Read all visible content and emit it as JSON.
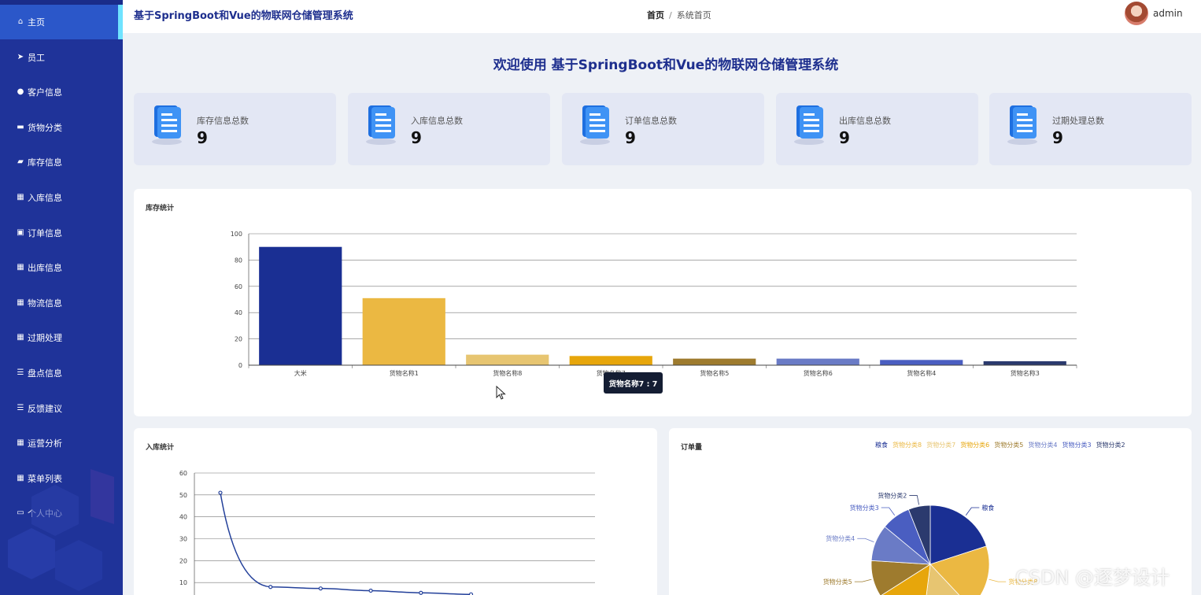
{
  "app": {
    "title": "基于SpringBoot和Vue的物联网仓储管理系统"
  },
  "sidebar": {
    "items": [
      {
        "label": "主页",
        "icon": "home-icon",
        "glyph": "⌂"
      },
      {
        "label": "员工",
        "icon": "paper-plane-icon",
        "glyph": "➤"
      },
      {
        "label": "客户信息",
        "icon": "user-icon",
        "glyph": "●"
      },
      {
        "label": "货物分类",
        "icon": "briefcase-icon",
        "glyph": "▬"
      },
      {
        "label": "库存信息",
        "icon": "thumb-icon",
        "glyph": "▰"
      },
      {
        "label": "入库信息",
        "icon": "grid-icon",
        "glyph": "▦"
      },
      {
        "label": "订单信息",
        "icon": "clipboard-icon",
        "glyph": "▣"
      },
      {
        "label": "出库信息",
        "icon": "grid-icon",
        "glyph": "▦"
      },
      {
        "label": "物流信息",
        "icon": "grid-icon",
        "glyph": "▦"
      },
      {
        "label": "过期处理",
        "icon": "grid-icon",
        "glyph": "▦"
      },
      {
        "label": "盘点信息",
        "icon": "list-icon",
        "glyph": "☰"
      },
      {
        "label": "反馈建议",
        "icon": "list-icon",
        "glyph": "☰"
      },
      {
        "label": "运营分析",
        "icon": "grid-icon",
        "glyph": "▦"
      },
      {
        "label": "菜单列表",
        "icon": "th-icon",
        "glyph": "▦"
      },
      {
        "label": "个人中心",
        "icon": "id-card-icon",
        "glyph": "▭"
      }
    ]
  },
  "breadcrumb": {
    "home": "首页",
    "separator": "/",
    "current": "系统首页"
  },
  "user": {
    "name": "admin"
  },
  "welcome": "欢迎使用 基于SpringBoot和Vue的物联网仓储管理系统",
  "stats": [
    {
      "label": "库存信息总数",
      "value": "9"
    },
    {
      "label": "入库信息总数",
      "value": "9"
    },
    {
      "label": "订单信息总数",
      "value": "9"
    },
    {
      "label": "出库信息总数",
      "value": "9"
    },
    {
      "label": "过期处理总数",
      "value": "9"
    }
  ],
  "panels": {
    "inventory": "库存统计",
    "inbound": "入库统计",
    "orders": "订单量"
  },
  "tooltip": "货物名称7 : 7",
  "watermark": "CSDN @逐梦设计",
  "chart_data": [
    {
      "type": "bar",
      "title": "库存统计",
      "categories": [
        "大米",
        "货物名称1",
        "货物名称8",
        "货物名称7",
        "货物名称5",
        "货物名称6",
        "货物名称4",
        "货物名称3"
      ],
      "values": [
        90,
        51,
        8,
        7,
        5,
        5,
        4,
        3
      ],
      "colors": [
        "#1a2f93",
        "#ebb842",
        "#e7c571",
        "#e7a60b",
        "#9e7b2e",
        "#6a7bc6",
        "#4a5ec1",
        "#2b3a6e"
      ],
      "ylim": [
        0,
        100
      ],
      "yticks": [
        0,
        20,
        40,
        60,
        80,
        100
      ],
      "grid": true
    },
    {
      "type": "line",
      "title": "入库统计",
      "values": [
        51,
        8,
        7.3,
        6.3,
        5.3,
        4.6
      ],
      "ylim": [
        0,
        60
      ],
      "yticks": [
        10,
        20,
        30,
        40,
        50,
        60
      ],
      "color": "#23409a",
      "grid": true
    },
    {
      "type": "pie",
      "title": "订单量",
      "legend_position": "top-right",
      "legend": [
        {
          "name": "粮食",
          "color": "#1a2f93"
        },
        {
          "name": "货物分类8",
          "color": "#ebb842"
        },
        {
          "name": "货物分类7",
          "color": "#e7c571"
        },
        {
          "name": "货物分类6",
          "color": "#e7a60b"
        },
        {
          "name": "货物分类5",
          "color": "#9e7b2e"
        },
        {
          "name": "货物分类4",
          "color": "#6a7bc6"
        },
        {
          "name": "货物分类3",
          "color": "#4a5ec1"
        },
        {
          "name": "货物分类2",
          "color": "#2b3a6e"
        }
      ],
      "slices": [
        {
          "name": "粮食",
          "value": 20,
          "color": "#1a2f93"
        },
        {
          "name": "货物分类8",
          "value": 18,
          "color": "#ebb842"
        },
        {
          "name": "货物分类7",
          "value": 14,
          "color": "#e7c571"
        },
        {
          "name": "货物分类6",
          "value": 14,
          "color": "#e7a60b"
        },
        {
          "name": "货物分类5",
          "value": 10,
          "color": "#9e7b2e"
        },
        {
          "name": "货物分类4",
          "value": 10,
          "color": "#6a7bc6"
        },
        {
          "name": "货物分类3",
          "value": 8,
          "color": "#4a5ec1"
        },
        {
          "name": "货物分类2",
          "value": 6,
          "color": "#2b3a6e"
        }
      ],
      "visible_labels": [
        "粮食",
        "货物分类8",
        "货物分类5",
        "货物分类4",
        "货物分类3",
        "货物分类2"
      ]
    }
  ]
}
